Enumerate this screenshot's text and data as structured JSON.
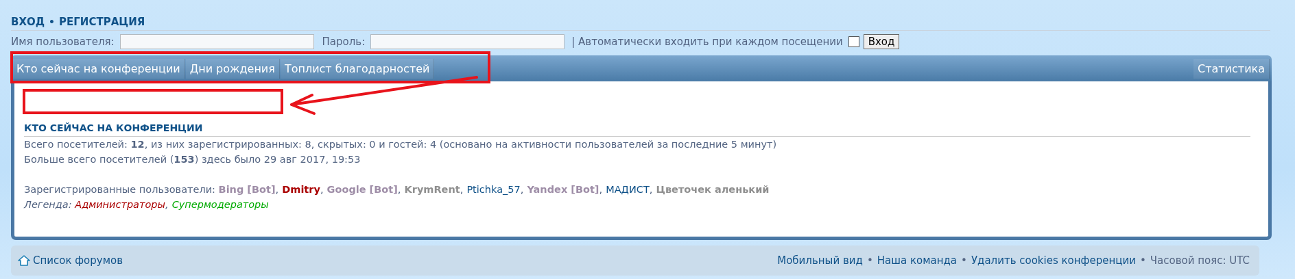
{
  "header_links": {
    "items": [
      "ВХОД",
      "РЕГИСТРАЦИЯ"
    ],
    "separator": "•"
  },
  "login": {
    "username_label": "Имя пользователя:",
    "password_label": "Пароль:",
    "autologin_label": "| Автоматически входить при каждом посещении",
    "autologin_checked": false,
    "submit": "Вход"
  },
  "nav_tabs": [
    "Кто сейчас на конференции",
    "Дни рождения",
    "Топлист благодарностей"
  ],
  "nav_right": "Статистика",
  "online": {
    "heading": "КТО СЕЙЧАС НА КОНФЕРЕНЦИИ",
    "lines": [
      "Всего посетителей: **12**, из них зарегистрированных: 8, скрытых: 0 и гостей: 4 (основано на активности пользователей за последние 5 минут)",
      "Больше всего посетителей (**153**) здесь было 29 авг 2017, 19:53"
    ],
    "users_label": "Зарегистрированные пользователи:",
    "users": [
      {
        "name": "Bing [Bot]",
        "color": "#9e8da7",
        "bold": true
      },
      {
        "name": "Dmitry",
        "color": "#aa0000",
        "bold": true
      },
      {
        "name": "Google [Bot]",
        "color": "#9e8da7",
        "bold": true
      },
      {
        "name": "KrymRent",
        "color": "#8f8f8f",
        "bold": true
      },
      {
        "name": "Ptichka_57",
        "color": "#105289",
        "bold": false
      },
      {
        "name": "Yandex [Bot]",
        "color": "#9e8da7",
        "bold": true
      },
      {
        "name": "МАДИСТ",
        "color": "#105289",
        "bold": false
      },
      {
        "name": "Цветочек аленький",
        "color": "#8f8f8f",
        "bold": true
      }
    ],
    "list_separator": ",",
    "legend_label": "Легенда:",
    "legend": [
      {
        "name": "Администраторы",
        "color": "#aa0000"
      },
      {
        "name": "Супермодераторы",
        "color": "#00aa00"
      }
    ]
  },
  "footer": {
    "home": "Список форумов",
    "links": [
      "Мобильный вид",
      "Наша команда",
      "Удалить cookies конференции"
    ],
    "timezone": "Часовой пояс: UTC",
    "separator": "•"
  }
}
